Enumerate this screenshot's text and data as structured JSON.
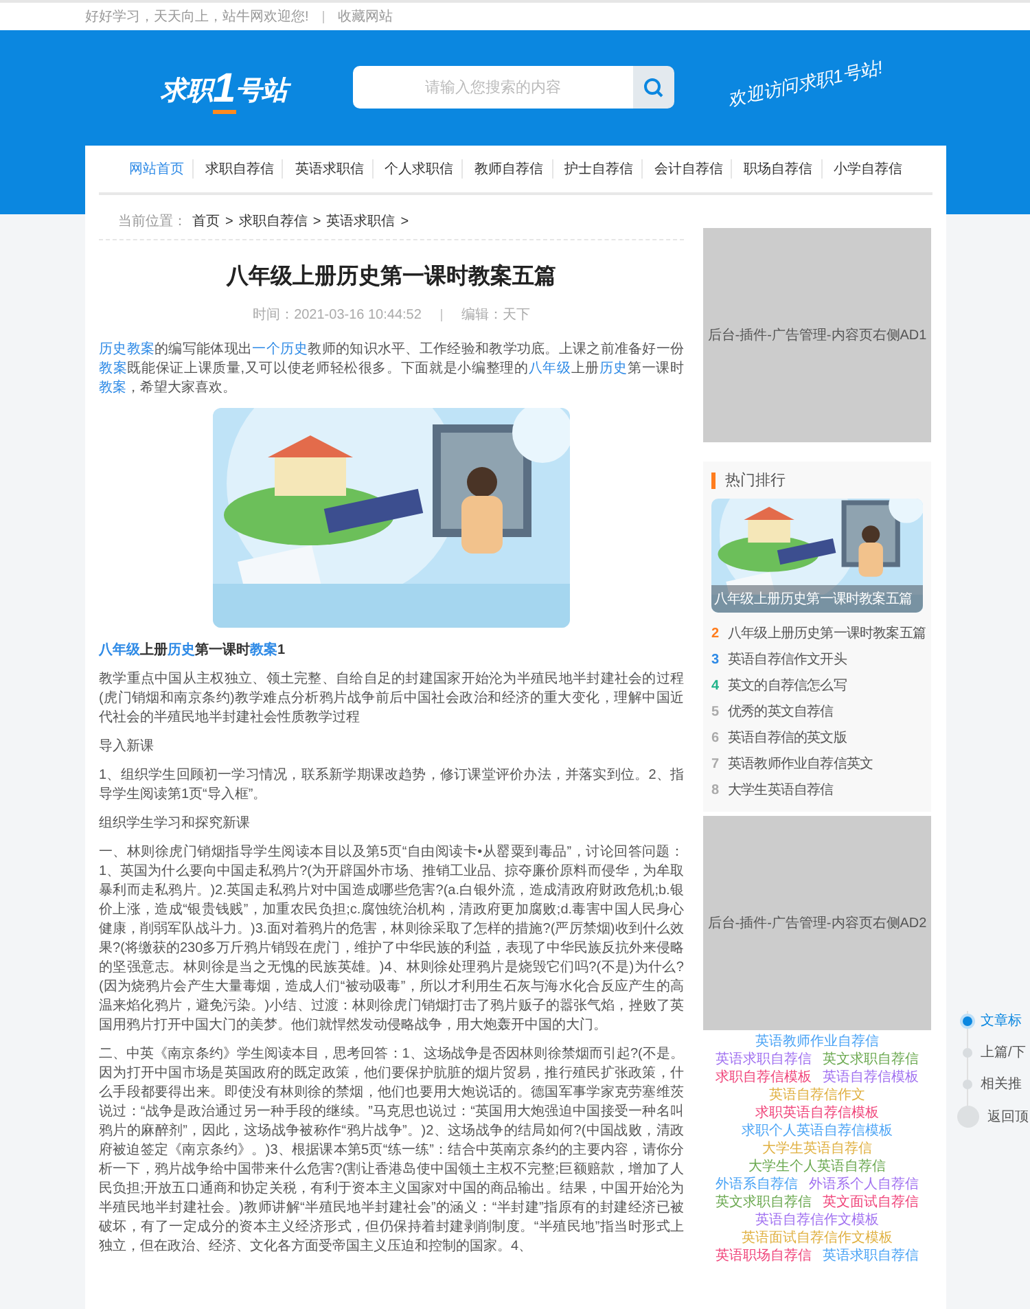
{
  "top_bar": {
    "slogan": "好好学习，天天向上，站牛网欢迎您!",
    "bookmark_link": "收藏网站"
  },
  "header": {
    "logo": {
      "before": "求职",
      "number": "1",
      "after": "号站"
    },
    "search": {
      "placeholder": "请输入您搜索的内容"
    },
    "welcome": "欢迎访问求职1号站!"
  },
  "nav": [
    {
      "label": "网站首页",
      "selected": true
    },
    {
      "label": "求职自荐信",
      "selected": false
    },
    {
      "label": "英语求职信",
      "selected": false
    },
    {
      "label": "个人求职信",
      "selected": false
    },
    {
      "label": "教师自荐信",
      "selected": false
    },
    {
      "label": "护士自荐信",
      "selected": false
    },
    {
      "label": "会计自荐信",
      "selected": false
    },
    {
      "label": "职场自荐信",
      "selected": false
    },
    {
      "label": "小学自荐信",
      "selected": false
    }
  ],
  "breadcrumb": {
    "label": "当前位置：",
    "items": [
      {
        "text": "首页",
        "separator": ">"
      },
      {
        "text": "求职自荐信",
        "separator": ">"
      },
      {
        "text": "英语求职信",
        "separator": ">"
      }
    ]
  },
  "article": {
    "title": "八年级上册历史第一课时教案五篇",
    "time": "时间：2021-03-16 10:44:52",
    "editor": "编辑：天下",
    "intro": [
      {
        "link": "历史教案"
      },
      "的编写能体现出",
      {
        "link": "一个历史"
      },
      "教师的知识水平、工作经验和教学功底。上课之前准备好一份",
      {
        "link": "教案"
      },
      "既能保证上课质量,又可以使老师轻松很多。下面就是小编整理的",
      {
        "link": "八年级"
      },
      "上册",
      {
        "link": "历史"
      },
      "第一课时",
      {
        "link": "教案"
      },
      "，希望大家喜欢。"
    ],
    "image": {
      "kind": "picture"
    },
    "heading": [
      {
        "link": "八年级"
      },
      "上册",
      {
        "link": "历史"
      },
      "第一课时",
      {
        "link": "教案"
      },
      "1"
    ],
    "paragraphs": [
      "教学重点中国从主权独立、领土完整、自给自足的封建国家开始沦为半殖民地半封建社会的过程(虎门销烟和南京条约)教学难点分析鸦片战争前后中国社会政治和经济的重大变化，理解中国近代社会的半殖民地半封建社会性质教学过程",
      "导入新课",
      "1、组织学生回顾初一学习情况，联系新学期课改趋势，修订课堂评价办法，并落实到位。2、指导学生阅读第1页“导入框”。",
      "组织学生学习和探究新课",
      "一、林则徐虎门销烟指导学生阅读本目以及第5页“自由阅读卡•从罂粟到毒品”，讨论回答问题：1、英国为什么要向中国走私鸦片?(为开辟国外市场、推销工业品、掠夺廉价原料而侵华，为牟取暴利而走私鸦片。)2.英国走私鸦片对中国造成哪些危害?(a.白银外流，造成清政府财政危机;b.银价上涨，造成“银贵钱贱”，加重农民负担;c.腐蚀统治机构，清政府更加腐败;d.毒害中国人民身心健康，削弱军队战斗力。)3.面对着鸦片的危害，林则徐采取了怎样的措施?(严厉禁烟)收到什么效果?(将缴获的230多万斤鸦片销毁在虎门，维护了中华民族的利益，表现了中华民族反抗外来侵略的坚强意志。林则徐是当之无愧的民族英雄。)4、林则徐处理鸦片是烧毁它们吗?(不是)为什么?(因为烧鸦片会产生大量毒烟，造成人们“被动吸毒”，所以才利用生石灰与海水化合反应产生的高温来焰化鸦片，避免污染。)小结、过渡：林则徐虎门销烟打击了鸦片贩子的嚣张气焰，挫败了英国用鸦片打开中国大门的美梦。他们就悍然发动侵略战争，用大炮轰开中国的大门。",
      "二、中英《南京条约》学生阅读本目，思考回答：1、这场战争是否因林则徐禁烟而引起?(不是。因为打开中国市场是英国政府的既定政策，他们要保护肮脏的烟片贸易，推行殖民扩张政策，什么手段都要得出来。即使没有林则徐的禁烟，他们也要用大炮说话的。德国军事学家克劳塞维茨说过：“战争是政治通过另一种手段的继续。”马克思也说过：“英国用大炮强迫中国接受一种名叫鸦片的麻醉剂”，因此，这场战争被称作“鸦片战争”。)2、这场战争的结局如何?(中国战败，清政府被迫签定《南京条约》。)3、根据课本第5页“练一练”：结合中英南京条约的主要内容，请你分析一下，鸦片战争给中国带来什么危害?(割让香港岛使中国领土主权不完整;巨额赔款，增加了人民负担;开放五口通商和协定关税，有利于资本主义国家对中国的商品输出。结果，中国开始沦为半殖民地半封建社会。)教师讲解“半殖民地半封建社会”的涵义：“半封建”指原有的封建经济已被破坏，有了一定成分的资本主义经济形式，但仍保持着封建剥削制度。“半殖民地”指当时形式上独立，但在政治、经济、文化各方面受帝国主义压迫和控制的国家。4、"
    ]
  },
  "sidebar": {
    "ad_top": "后台-插件-广告管理-内容页右侧AD1",
    "hot": {
      "title": "热门排行",
      "feature": {
        "kind": "picture",
        "caption": "八年级上册历史第一课时教案五篇"
      },
      "items": [
        {
          "rank": "2",
          "title": "八年级上册历史第一课时教案五篇",
          "color": "#ff7d1e"
        },
        {
          "rank": "3",
          "title": "英语自荐信作文开头",
          "color": "#2e8ae6"
        },
        {
          "rank": "4",
          "title": "英文的自荐信怎么写",
          "color": "#1fb38a"
        },
        {
          "rank": "5",
          "title": "优秀的英文自荐信",
          "color": "#aaaaaa"
        },
        {
          "rank": "6",
          "title": "英语自荐信的英文版",
          "color": "#aaaaaa"
        },
        {
          "rank": "7",
          "title": "英语教师作业自荐信英文",
          "color": "#aaaaaa"
        },
        {
          "rank": "8",
          "title": "大学生英语自荐信",
          "color": "#aaaaaa"
        }
      ]
    },
    "ad_bottom": "后台-插件-广告管理-内容页右侧AD2",
    "tags": [
      {
        "text": "英语教师作业自荐信",
        "color": "#4aa3f5"
      },
      {
        "text": "英语求职自荐信",
        "color": "#a070f0"
      },
      {
        "text": "英文求职自荐信",
        "color": "#6aa84f"
      },
      {
        "text": "求职自荐信模板",
        "color": "#f0447a"
      },
      {
        "text": "英语自荐信模板",
        "color": "#a070f0"
      },
      {
        "text": "英语自荐信作文",
        "color": "#e0b040"
      },
      {
        "text": "求职英语自荐信模板",
        "color": "#f0447a"
      },
      {
        "text": "求职个人英语自荐信模板",
        "color": "#4aa3f5"
      },
      {
        "text": "大学生英语自荐信",
        "color": "#e0b040"
      },
      {
        "text": "大学生个人英语自荐信",
        "color": "#6aa84f"
      },
      {
        "text": "外语系自荐信",
        "color": "#4aa3f5"
      },
      {
        "text": "外语系个人自荐信",
        "color": "#a070f0"
      },
      {
        "text": "英文求职自荐信",
        "color": "#6aa84f"
      },
      {
        "text": "英文面试自荐信",
        "color": "#f0447a"
      },
      {
        "text": "英语自荐信作文模板",
        "color": "#a070f0"
      },
      {
        "text": "英语面试自荐信作文模板",
        "color": "#e0b040"
      },
      {
        "text": "英语职场自荐信",
        "color": "#f0447a"
      },
      {
        "text": "英语求职自荐信",
        "color": "#4aa3f5"
      }
    ]
  },
  "side_nav": [
    {
      "kind": "dot",
      "label": "文章标",
      "selected": true
    },
    {
      "kind": "dot",
      "label": "上篇/下",
      "selected": false
    },
    {
      "kind": "dot",
      "label": "相关推",
      "selected": false
    },
    {
      "kind": "top",
      "label": "返回顶",
      "selected": false
    }
  ]
}
